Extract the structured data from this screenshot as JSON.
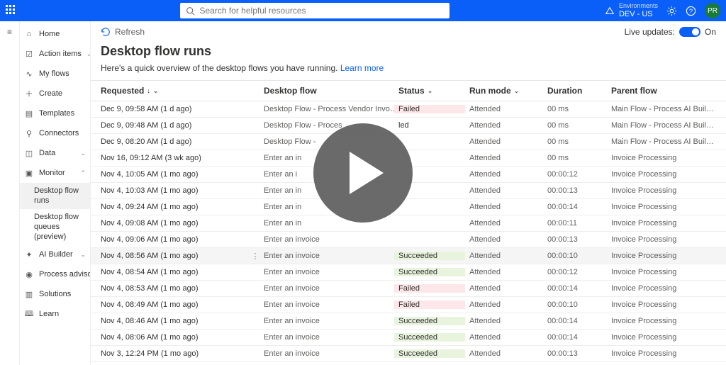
{
  "top": {
    "search_placeholder": "Search for helpful resources",
    "env_label": "Environments",
    "env_value": "DEV - US",
    "avatar": "PR"
  },
  "nav": {
    "home": "Home",
    "action_items": "Action items",
    "my_flows": "My flows",
    "create": "Create",
    "templates": "Templates",
    "connectors": "Connectors",
    "data": "Data",
    "monitor": "Monitor",
    "sub_runs": "Desktop flow runs",
    "sub_queues": "Desktop flow queues (preview)",
    "ai_builder": "AI Builder",
    "process_advisor": "Process advisor (preview)",
    "solutions": "Solutions",
    "learn": "Learn"
  },
  "toolbar": {
    "refresh": "Refresh",
    "live_label": "Live updates:",
    "live_state": "On"
  },
  "page": {
    "title": "Desktop flow runs",
    "subtitle_a": "Here's a quick overview of the desktop flows you have running. ",
    "subtitle_link": "Learn more"
  },
  "columns": {
    "requested": "Requested",
    "flow": "Desktop flow",
    "status": "Status",
    "mode": "Run mode",
    "duration": "Duration",
    "parent": "Parent flow"
  },
  "rows": [
    {
      "req": "Dec 9, 09:58 AM (1 d ago)",
      "flow": "Desktop Flow - Process Vendor Invoices",
      "status": "Failed",
      "mode": "Attended",
      "dur": "00 ms",
      "parent": "Main Flow - Process AI Builder Docu..."
    },
    {
      "req": "Dec 9, 09:48 AM (1 d ago)",
      "flow": "Desktop Flow - Proces",
      "status": "led",
      "mode": "Attended",
      "dur": "00 ms",
      "parent": "Main Flow - Process AI Builder Docu..."
    },
    {
      "req": "Dec 9, 08:20 AM (1 d ago)",
      "flow": "Desktop Flow -",
      "status": "",
      "mode": "Attended",
      "dur": "00 ms",
      "parent": "Main Flow - Process AI Builder Docu..."
    },
    {
      "req": "Nov 16, 09:12 AM (3 wk ago)",
      "flow": "Enter an in",
      "status": "",
      "mode": "Attended",
      "dur": "00 ms",
      "parent": "Invoice Processing"
    },
    {
      "req": "Nov 4, 10:05 AM (1 mo ago)",
      "flow": "Enter an i",
      "status": "",
      "statusClass": "succeeded",
      "mode": "Attended",
      "dur": "00:00:12",
      "parent": "Invoice Processing"
    },
    {
      "req": "Nov 4, 10:03 AM (1 mo ago)",
      "flow": "Enter an in",
      "status": "",
      "statusClass": "succeeded",
      "mode": "Attended",
      "dur": "00:00:13",
      "parent": "Invoice Processing"
    },
    {
      "req": "Nov 4, 09:24 AM (1 mo ago)",
      "flow": "Enter an in",
      "status": "",
      "statusClass": "succeeded",
      "mode": "Attended",
      "dur": "00:00:14",
      "parent": "Invoice Processing"
    },
    {
      "req": "Nov 4, 09:08 AM (1 mo ago)",
      "flow": "Enter an in",
      "status": "",
      "statusClass": "succeeded",
      "mode": "Attended",
      "dur": "00:00:11",
      "parent": "Invoice Processing"
    },
    {
      "req": "Nov 4, 09:06 AM (1 mo ago)",
      "flow": "Enter an invoice",
      "status": "",
      "statusClass": "failed",
      "mode": "Attended",
      "dur": "00:00:13",
      "parent": "Invoice Processing"
    },
    {
      "req": "Nov 4, 08:56 AM (1 mo ago)",
      "flow": "Enter an invoice",
      "status": "Succeeded",
      "statusClass": "succeeded",
      "mode": "Attended",
      "dur": "00:00:10",
      "parent": "Invoice Processing",
      "hover": true
    },
    {
      "req": "Nov 4, 08:54 AM (1 mo ago)",
      "flow": "Enter an invoice",
      "status": "Succeeded",
      "statusClass": "succeeded",
      "mode": "Attended",
      "dur": "00:00:12",
      "parent": "Invoice Processing"
    },
    {
      "req": "Nov 4, 08:53 AM (1 mo ago)",
      "flow": "Enter an invoice",
      "status": "Failed",
      "statusClass": "failed",
      "mode": "Attended",
      "dur": "00:00:14",
      "parent": "Invoice Processing"
    },
    {
      "req": "Nov 4, 08:49 AM (1 mo ago)",
      "flow": "Enter an invoice",
      "status": "Failed",
      "statusClass": "failed",
      "mode": "Attended",
      "dur": "00:00:10",
      "parent": "Invoice Processing"
    },
    {
      "req": "Nov 4, 08:46 AM (1 mo ago)",
      "flow": "Enter an invoice",
      "status": "Succeeded",
      "statusClass": "succeeded",
      "mode": "Attended",
      "dur": "00:00:14",
      "parent": "Invoice Processing"
    },
    {
      "req": "Nov 4, 08:06 AM (1 mo ago)",
      "flow": "Enter an invoice",
      "status": "Succeeded",
      "statusClass": "succeeded",
      "mode": "Attended",
      "dur": "00:00:14",
      "parent": "Invoice Processing"
    },
    {
      "req": "Nov 3, 12:24 PM (1 mo ago)",
      "flow": "Enter an invoice",
      "status": "Succeeded",
      "statusClass": "succeeded",
      "mode": "Attended",
      "dur": "00:00:13",
      "parent": "Invoice Processing"
    }
  ]
}
